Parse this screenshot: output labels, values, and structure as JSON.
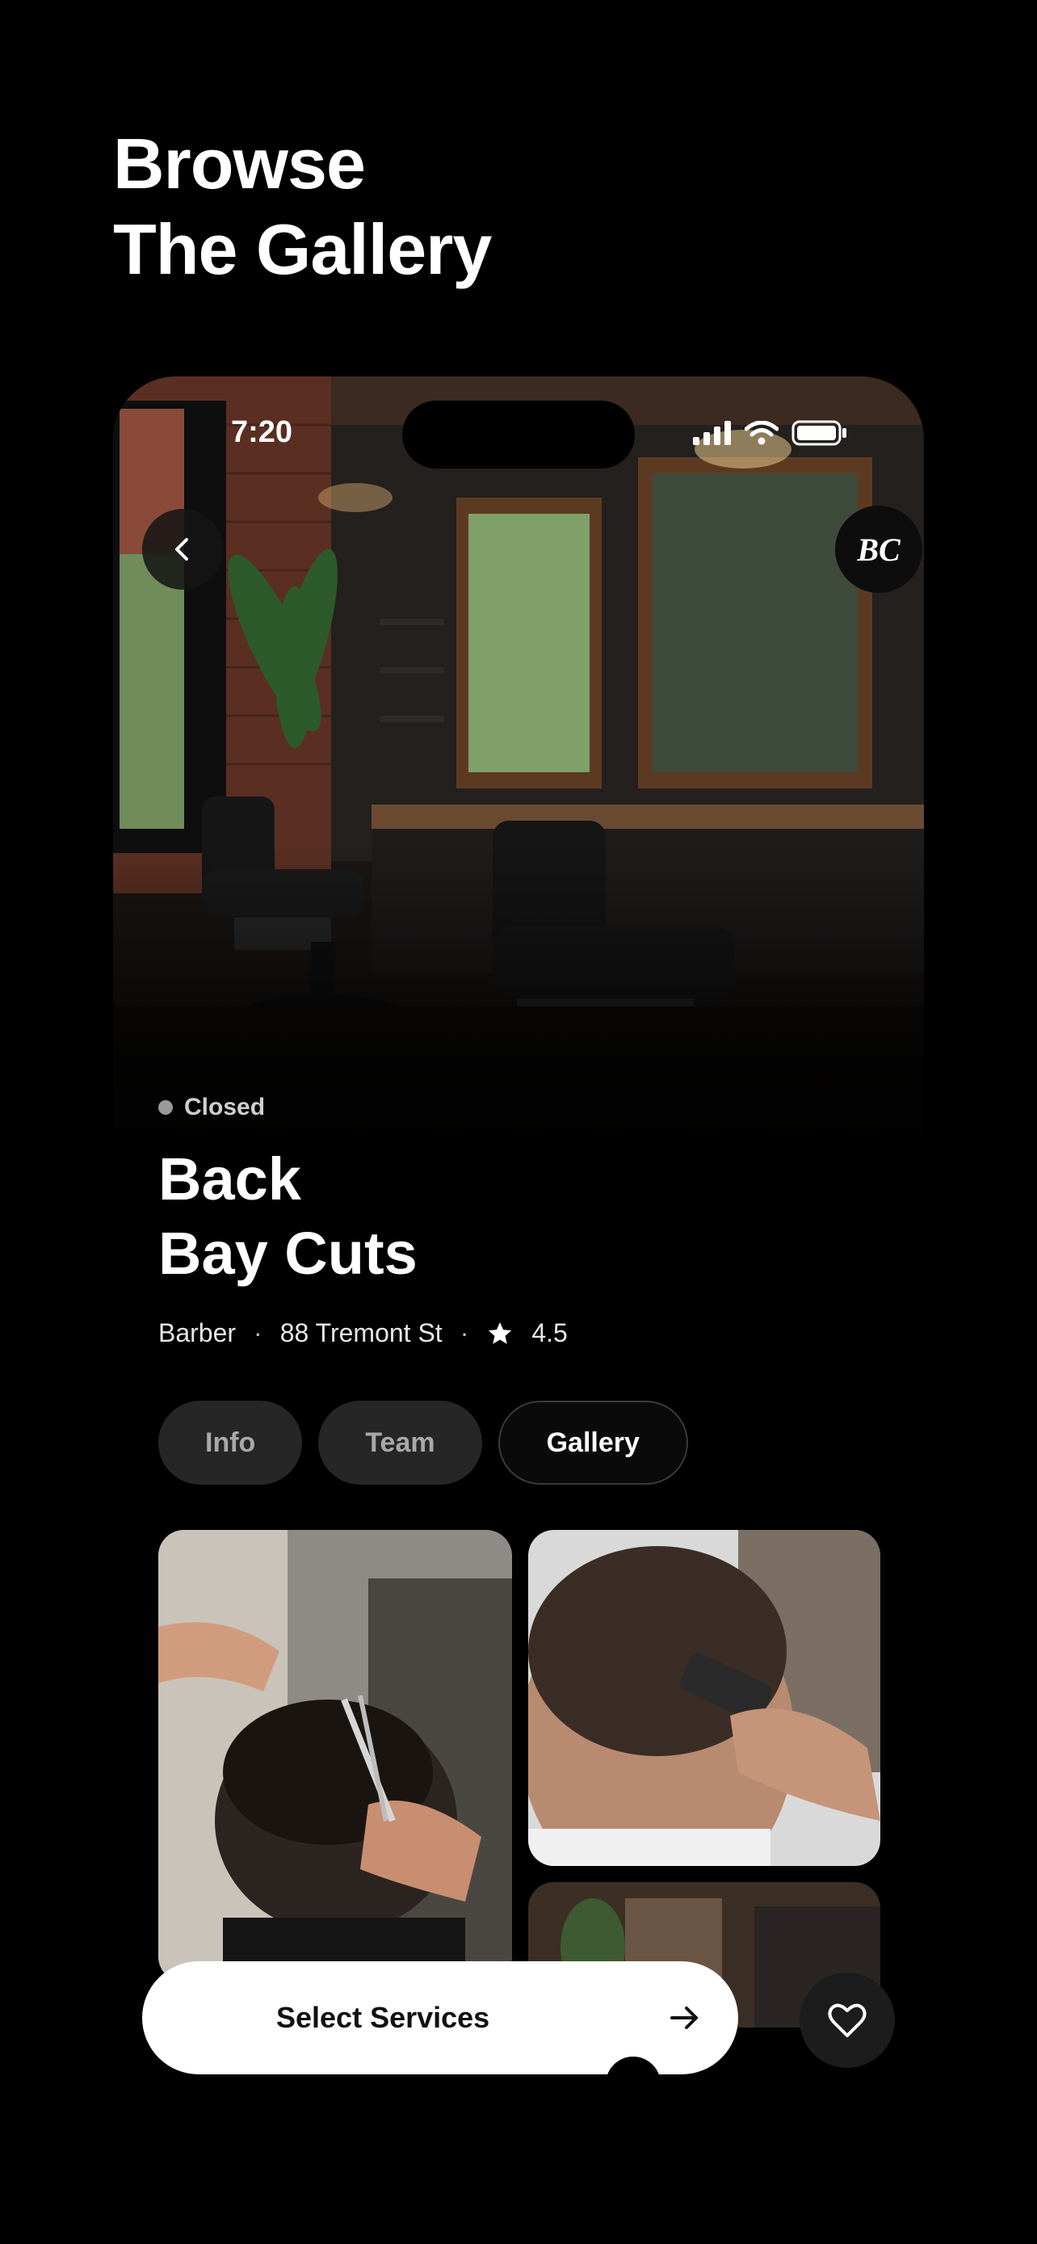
{
  "page": {
    "heading_line1": "Browse",
    "heading_line2": "The Gallery"
  },
  "status_bar": {
    "time": "7:20"
  },
  "header": {
    "back_icon": "chevron-left-icon",
    "logo_text": "BC"
  },
  "shop": {
    "status": "Closed",
    "name_line1": "Back",
    "name_line2": "Bay Cuts",
    "category": "Barber",
    "address": "88 Tremont St",
    "rating": "4.5",
    "rating_icon": "star-icon"
  },
  "tabs": [
    {
      "label": "Info",
      "active": false
    },
    {
      "label": "Team",
      "active": false
    },
    {
      "label": "Gallery",
      "active": true
    }
  ],
  "gallery": {
    "images": [
      {
        "alt": "scissor-cut-photo"
      },
      {
        "alt": "clipper-fade-photo"
      },
      {
        "alt": "shop-interior-photo"
      }
    ]
  },
  "actions": {
    "select_services_label": "Select Services",
    "arrow_icon": "arrow-right-icon",
    "favorite_icon": "heart-icon"
  },
  "colors": {
    "background": "#000000",
    "cta_background": "#ffffff",
    "tab_inactive": "#262626",
    "status_dot": "#9a9a9a"
  }
}
